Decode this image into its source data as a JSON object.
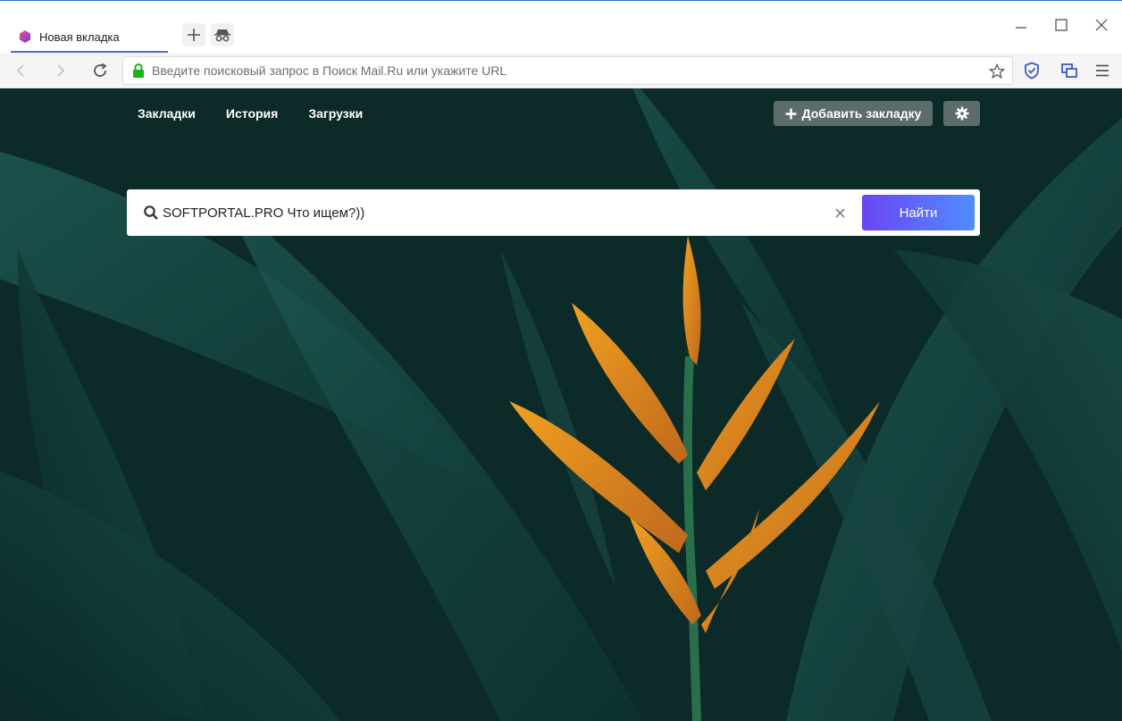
{
  "tab": {
    "title": "Новая вкладка"
  },
  "toolbar": {
    "url_placeholder": "Введите поисковый запрос в Поиск Mail.Ru или укажите URL"
  },
  "topnav": {
    "items": [
      "Закладки",
      "История",
      "Загрузки"
    ]
  },
  "actions": {
    "add_bookmark": "Добавить закладку"
  },
  "search": {
    "value": "SOFTPORTAL.PRO Что ищем?))",
    "button": "Найти"
  },
  "colors": {
    "accent_start": "#6b45f2",
    "accent_end": "#4f8dff",
    "secure_lock": "#19b31a",
    "tab_underline": "#4a6fd8"
  },
  "icons": [
    "atom-browser-logo-icon",
    "new-tab-icon",
    "incognito-icon",
    "minimize-icon",
    "maximize-icon",
    "close-icon",
    "back-icon",
    "forward-icon",
    "reload-icon",
    "lock-icon",
    "star-icon",
    "shield-icon",
    "tabs-icon",
    "menu-icon",
    "plus-icon",
    "gear-icon",
    "search-icon",
    "clear-icon"
  ]
}
